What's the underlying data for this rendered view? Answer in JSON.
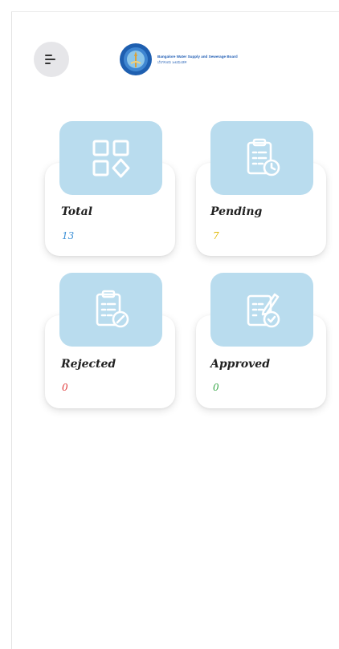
{
  "header": {
    "menu_icon": "menu-icon",
    "logo": {
      "icon": "bwssb-seal-logo",
      "line1": "Bangalore Water Supply and Sewerage Board",
      "line2": "ಬೆಂಗಳೂರು ಜಲಮಂಡಳಿ"
    }
  },
  "stats": [
    {
      "label": "Total",
      "value": "13",
      "icon": "grid-shapes-icon",
      "value_color": "#3a8fd6"
    },
    {
      "label": "Pending",
      "value": "7",
      "icon": "clipboard-clock-icon",
      "value_color": "#e0b800"
    },
    {
      "label": "Rejected",
      "value": "0",
      "icon": "clipboard-rejected-icon",
      "value_color": "#e03a3a"
    },
    {
      "label": "Approved",
      "value": "0",
      "icon": "clipboard-approved-icon",
      "value_color": "#3aa84a"
    }
  ],
  "colors": {
    "icon_box": "#b9dcee",
    "icon_stroke": "#ffffff",
    "menu_button_bg": "#e6e6e9"
  }
}
